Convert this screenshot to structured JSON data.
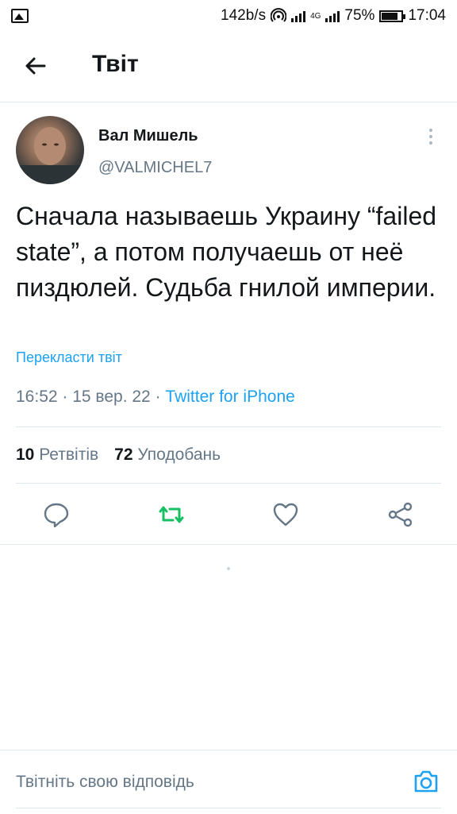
{
  "status_bar": {
    "net_speed": "142b/s",
    "network_type": "4G",
    "battery": "75%",
    "time": "17:04"
  },
  "header": {
    "title": "Твіт",
    "back_icon": "arrow-left-icon"
  },
  "tweet": {
    "author_name": "Вал Мишель",
    "author_handle": "@VALMICHEL7",
    "text": "Сначала называешь Украину “failed state”, а потом получаешь от неё пиздюлей. Судьба гнилой империи.",
    "translate_label": "Перекласти твіт",
    "time": "16:52",
    "date": "15 вер. 22",
    "source": "Twitter for iPhone",
    "retweets_count": "10",
    "retweets_label": "Ретвітів",
    "likes_count": "72",
    "likes_label": "Уподобань"
  },
  "actions": {
    "reply_icon": "reply-icon",
    "retweet_icon": "retweet-icon",
    "like_icon": "heart-icon",
    "share_icon": "share-icon"
  },
  "reply": {
    "placeholder": "Твітніть свою відповідь",
    "camera_icon": "camera-icon"
  },
  "colors": {
    "accent": "#1da1f2",
    "retweet_active": "#17bf63",
    "secondary_text": "#657786",
    "divider": "#e1e8ed"
  }
}
